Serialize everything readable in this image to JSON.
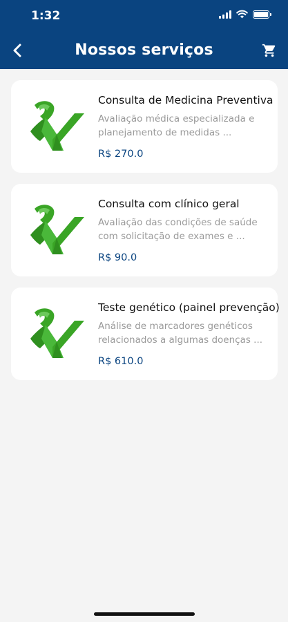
{
  "status_bar": {
    "time": "1:32"
  },
  "nav": {
    "title": "Nossos serviços",
    "back_icon": "chevron-left-icon",
    "cart_icon": "cart-icon"
  },
  "colors": {
    "header": "#0a4480",
    "price": "#0a4480",
    "logo_green": "#3aa526",
    "background": "#f4f4f4"
  },
  "services": [
    {
      "title": "Consulta de Medicina Preventiva",
      "description": "Avaliação médica especializada e planejamento de medidas ...",
      "price": "R$ 270.0"
    },
    {
      "title": "Consulta com clínico geral",
      "description": "Avaliação das condições de saúde com solicitação de exames e ...",
      "price": "R$ 90.0"
    },
    {
      "title": "Teste genético (painel prevenção)",
      "description": "Análise de marcadores genéticos relacionados a algumas doenças ...",
      "price": "R$ 610.0"
    }
  ]
}
